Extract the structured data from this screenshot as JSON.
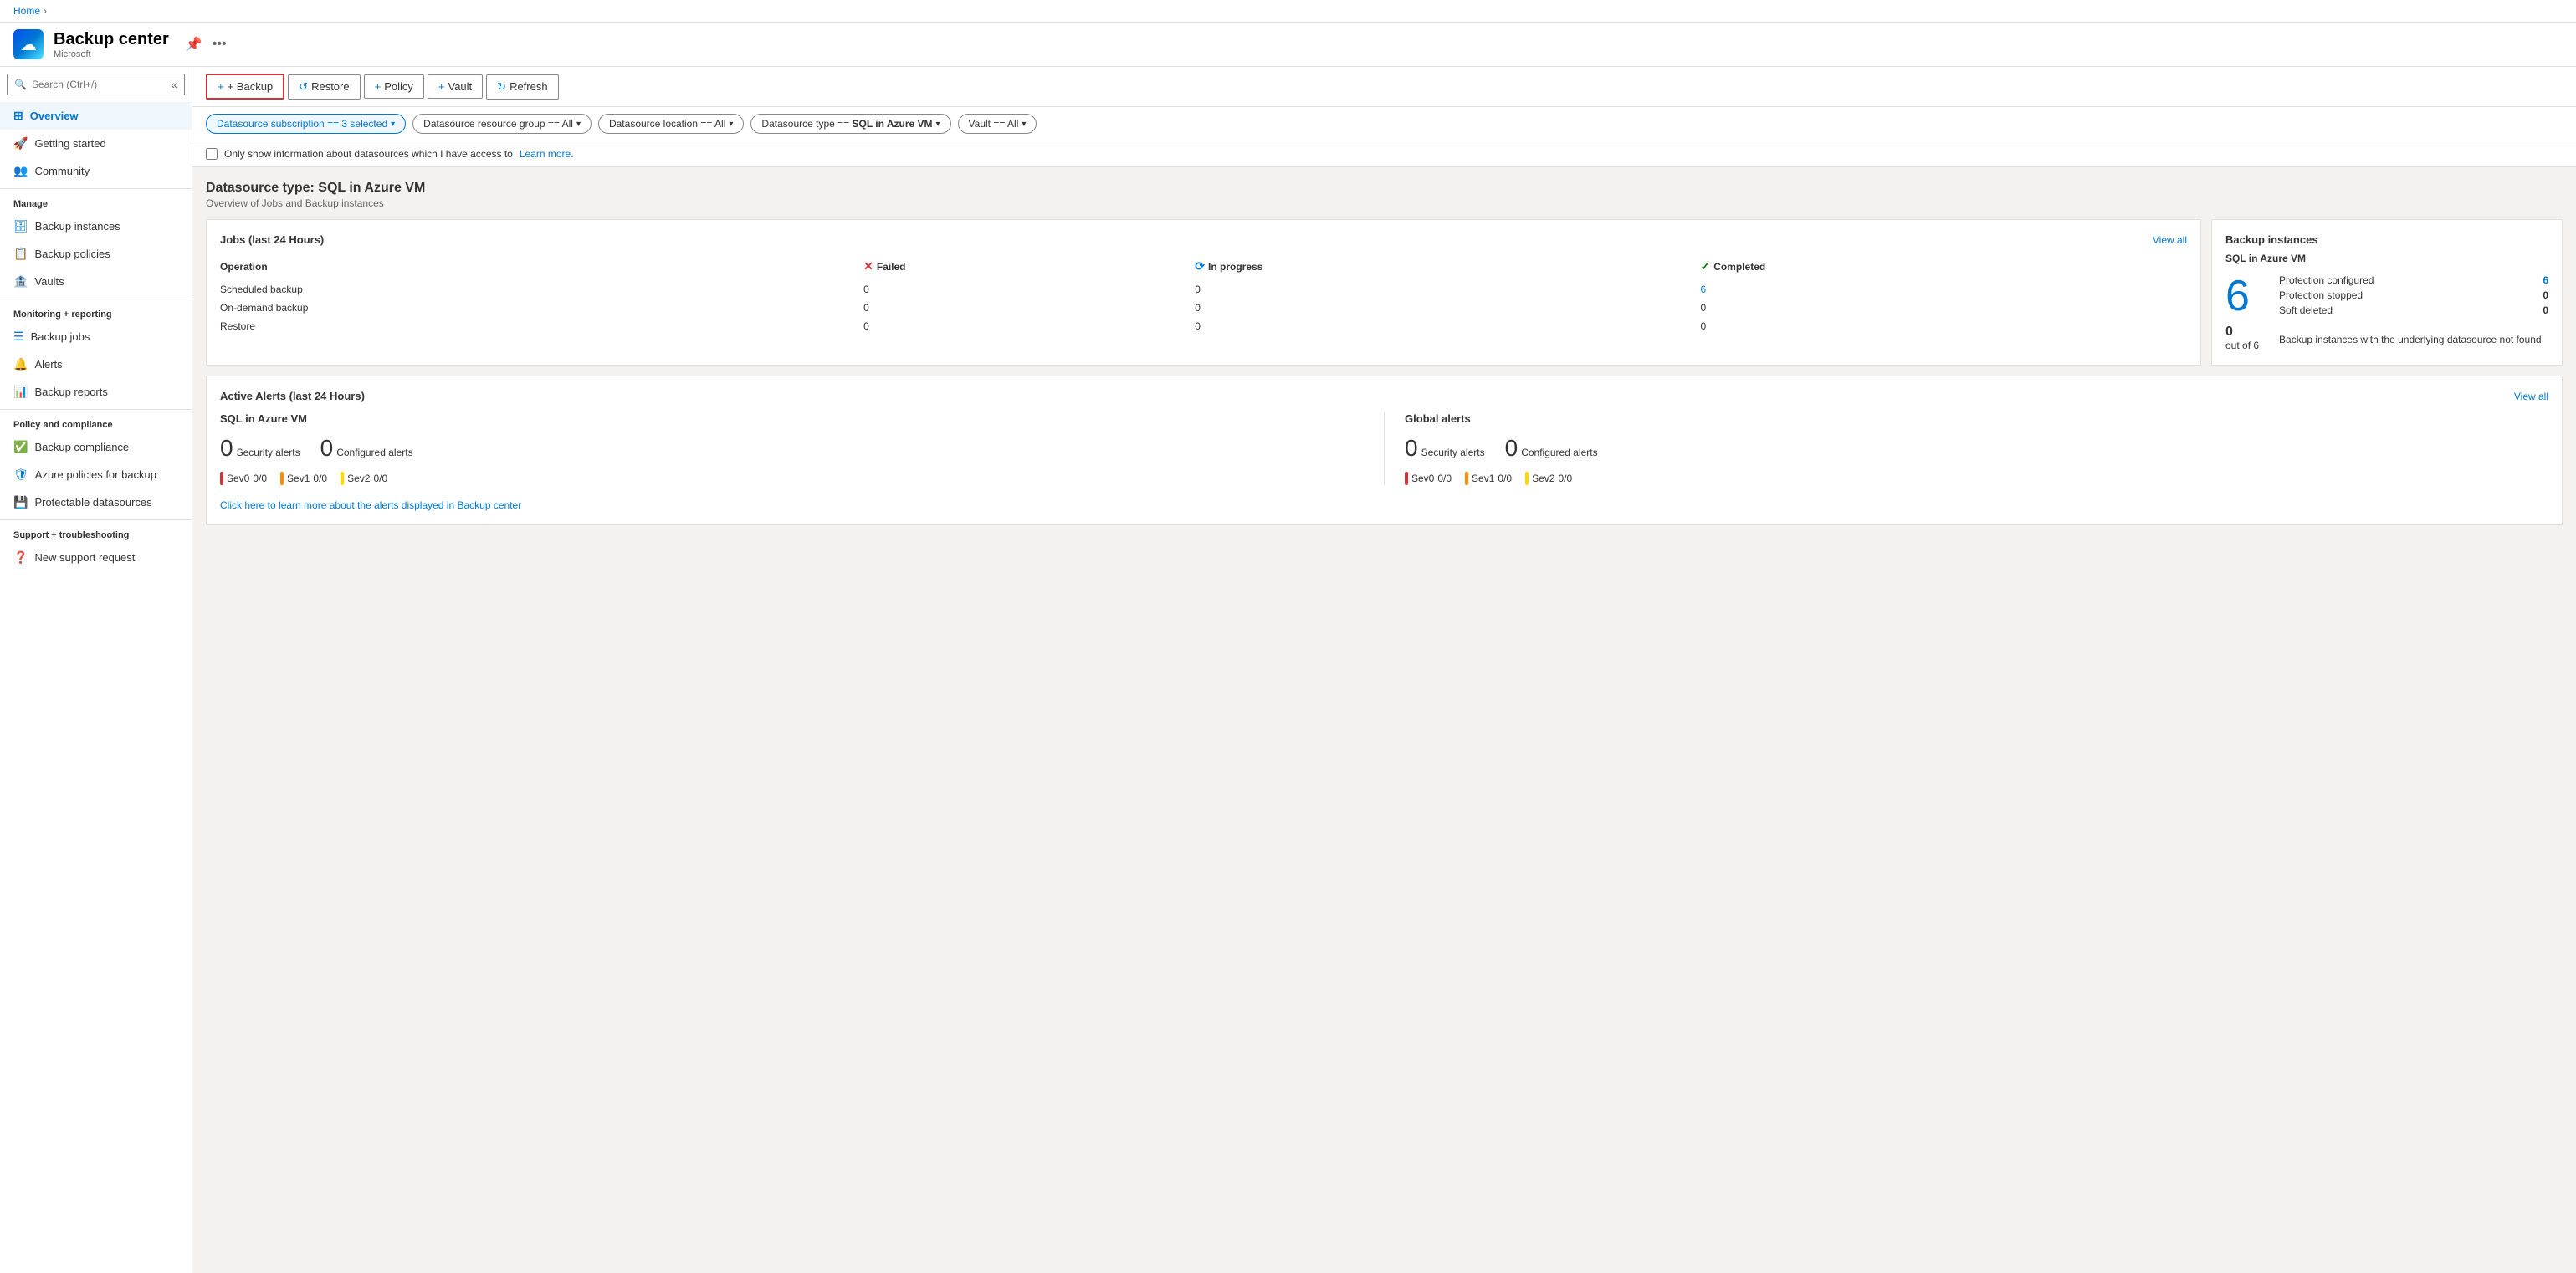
{
  "app": {
    "title": "Backup center",
    "subtitle": "Microsoft",
    "icon": "☁"
  },
  "breadcrumb": {
    "home": "Home",
    "separator": "›"
  },
  "search": {
    "placeholder": "Search (Ctrl+/)"
  },
  "toolbar": {
    "backup_label": "+ Backup",
    "restore_label": "↺ Restore",
    "policy_label": "+ Policy",
    "vault_label": "+ Vault",
    "refresh_label": "↻ Refresh"
  },
  "filters": [
    {
      "label": "Datasource subscription == 3 selected",
      "active": true
    },
    {
      "label": "Datasource resource group == All",
      "active": false
    },
    {
      "label": "Datasource location == All",
      "active": false
    },
    {
      "label": "Datasource type == SQL in Azure VM",
      "active": false
    },
    {
      "label": "Vault == All",
      "active": false
    }
  ],
  "checkbox_row": {
    "label": "Only show information about datasources which I have access to",
    "link_text": "Learn more."
  },
  "datasource": {
    "title": "Datasource type: SQL in Azure VM",
    "subtitle": "Overview of Jobs and Backup instances"
  },
  "jobs_card": {
    "title": "Jobs (last 24 Hours)",
    "view_all": "View all",
    "columns": {
      "operation": "Operation",
      "failed": "Failed",
      "in_progress": "In progress",
      "completed": "Completed"
    },
    "rows": [
      {
        "operation": "Scheduled backup",
        "failed": "0",
        "in_progress": "0",
        "completed": "6"
      },
      {
        "operation": "On-demand backup",
        "failed": "0",
        "in_progress": "0",
        "completed": "0"
      },
      {
        "operation": "Restore",
        "failed": "0",
        "in_progress": "0",
        "completed": "0"
      }
    ]
  },
  "backup_instances_card": {
    "title": "Backup instances",
    "datasource_type": "SQL in Azure VM",
    "big_number": "6",
    "stats": [
      {
        "label": "Protection configured",
        "value": "6",
        "is_link": true
      },
      {
        "label": "Protection stopped",
        "value": "0",
        "is_link": false
      },
      {
        "label": "Soft deleted",
        "value": "0",
        "is_link": false
      }
    ],
    "out_of_val": "0",
    "out_of_total": "out of 6",
    "out_of_desc": "Backup instances with the underlying datasource not found"
  },
  "alerts_card": {
    "title": "Active Alerts (last 24 Hours)",
    "view_all": "View all",
    "sql_section": {
      "title": "SQL in Azure VM",
      "security_count": "0",
      "security_label": "Security alerts",
      "configured_count": "0",
      "configured_label": "Configured alerts",
      "severities": [
        {
          "name": "Sev0",
          "value": "0/0",
          "color": "red"
        },
        {
          "name": "Sev1",
          "value": "0/0",
          "color": "orange"
        },
        {
          "name": "Sev2",
          "value": "0/0",
          "color": "yellow"
        }
      ]
    },
    "global_section": {
      "title": "Global alerts",
      "security_count": "0",
      "security_label": "Security alerts",
      "configured_count": "0",
      "configured_label": "Configured alerts",
      "severities": [
        {
          "name": "Sev0",
          "value": "0/0",
          "color": "red"
        },
        {
          "name": "Sev1",
          "value": "0/0",
          "color": "orange"
        },
        {
          "name": "Sev2",
          "value": "0/0",
          "color": "yellow"
        }
      ]
    },
    "footer_link": "Click here to learn more about the alerts displayed in Backup center"
  },
  "sidebar": {
    "items": [
      {
        "id": "overview",
        "label": "Overview",
        "section": null,
        "active": true
      },
      {
        "id": "getting-started",
        "label": "Getting started",
        "section": null
      },
      {
        "id": "community",
        "label": "Community",
        "section": null
      },
      {
        "id": "manage-header",
        "label": "Manage",
        "section": "header"
      },
      {
        "id": "backup-instances",
        "label": "Backup instances",
        "section": "manage"
      },
      {
        "id": "backup-policies",
        "label": "Backup policies",
        "section": "manage"
      },
      {
        "id": "vaults",
        "label": "Vaults",
        "section": "manage"
      },
      {
        "id": "monitoring-header",
        "label": "Monitoring + reporting",
        "section": "header"
      },
      {
        "id": "backup-jobs",
        "label": "Backup jobs",
        "section": "monitoring"
      },
      {
        "id": "alerts",
        "label": "Alerts",
        "section": "monitoring"
      },
      {
        "id": "backup-reports",
        "label": "Backup reports",
        "section": "monitoring"
      },
      {
        "id": "policy-header",
        "label": "Policy and compliance",
        "section": "header"
      },
      {
        "id": "backup-compliance",
        "label": "Backup compliance",
        "section": "policy"
      },
      {
        "id": "azure-policies",
        "label": "Azure policies for backup",
        "section": "policy"
      },
      {
        "id": "protectable",
        "label": "Protectable datasources",
        "section": "policy"
      },
      {
        "id": "support-header",
        "label": "Support + troubleshooting",
        "section": "header"
      },
      {
        "id": "new-support",
        "label": "New support request",
        "section": "support"
      }
    ]
  }
}
